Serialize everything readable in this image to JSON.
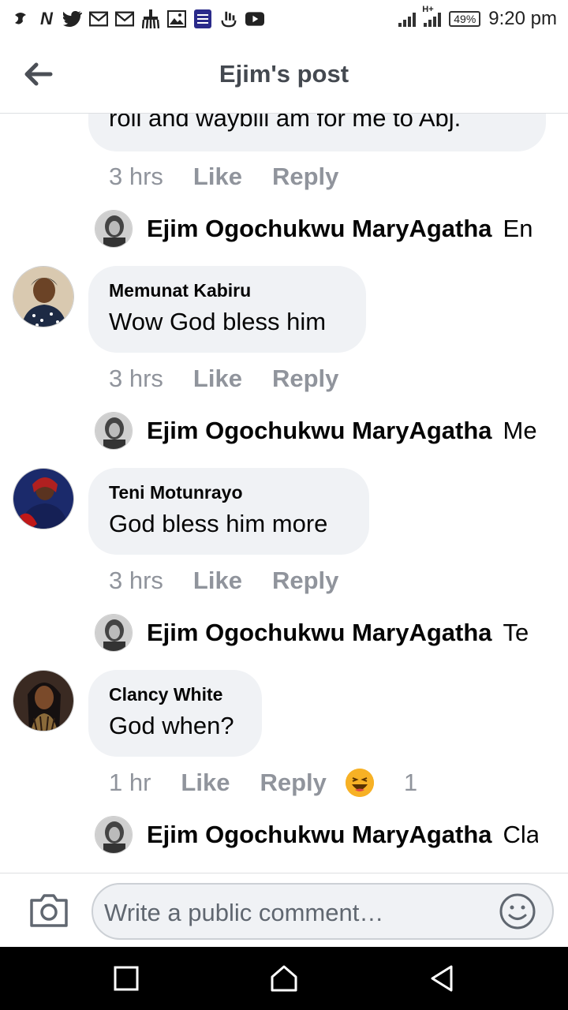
{
  "status_bar": {
    "left_icons": [
      "app-icon",
      "netflix-n-icon",
      "twitter-icon",
      "gmail-icon",
      "gmail-icon",
      "cleaner-icon",
      "gallery-icon",
      "bible-app-icon",
      "accessibility-icon",
      "youtube-icon"
    ],
    "network": "H+",
    "battery": "49%",
    "time": "9:20 pm"
  },
  "header": {
    "title": "Ejim's post"
  },
  "comments": [
    {
      "partial": true,
      "text": "roll and waybill am for me to Abj.",
      "time": "3 hrs",
      "like": "Like",
      "reply": "Reply",
      "reply_preview": {
        "name": "Ejim Ogochukwu MaryAgatha",
        "snippet": "En"
      }
    },
    {
      "name": "Memunat Kabiru",
      "text": "Wow God bless him",
      "time": "3 hrs",
      "like": "Like",
      "reply": "Reply",
      "reply_preview": {
        "name": "Ejim Ogochukwu MaryAgatha",
        "snippet": "Me"
      }
    },
    {
      "name": "Teni Motunrayo",
      "text": "God bless him more",
      "time": "3 hrs",
      "like": "Like",
      "reply": "Reply",
      "reply_preview": {
        "name": "Ejim Ogochukwu MaryAgatha",
        "snippet": "Te"
      }
    },
    {
      "name": "Clancy White",
      "text": "God when?",
      "time": "1 hr",
      "like": "Like",
      "reply": "Reply",
      "reactions": {
        "icon": "haha-emoji-icon",
        "count": "1"
      },
      "reply_preview": {
        "name": "Ejim Ogochukwu MaryAgatha",
        "snippet": "Cla"
      }
    }
  ],
  "composer": {
    "placeholder": "Write a public comment…"
  },
  "colors": {
    "bubble": "#f0f2f5",
    "meta_text": "#90949c",
    "header_text": "#444950",
    "nav_bar": "#000000"
  }
}
